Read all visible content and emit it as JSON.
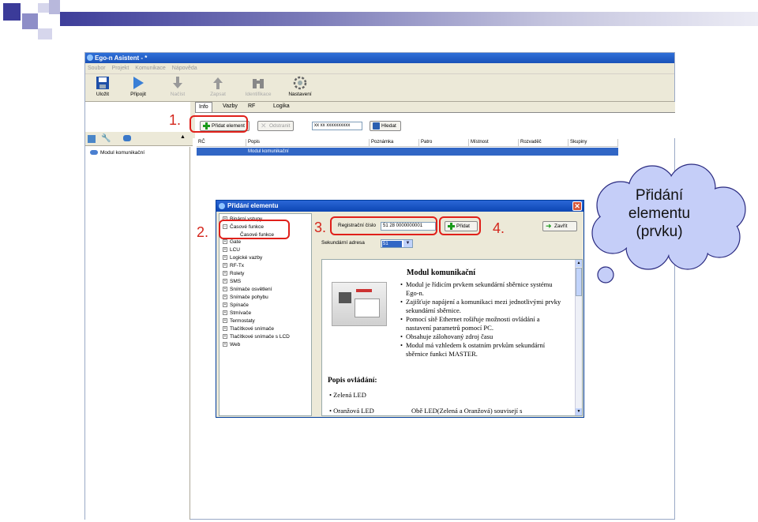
{
  "app": {
    "title": "Ego-n Asistent - *",
    "menu": [
      "Soubor",
      "Projekt",
      "Komunikace",
      "Nápověda"
    ],
    "toolbar": [
      {
        "label": "Uložit",
        "icon": "save-icon"
      },
      {
        "label": "Připojit",
        "icon": "connect-icon"
      },
      {
        "label": "Načíst",
        "icon": "download-icon"
      },
      {
        "label": "Zapsat",
        "icon": "upload-icon"
      },
      {
        "label": "Identifikace",
        "icon": "binoculars-icon"
      },
      {
        "label": "Nastavení",
        "icon": "gear-icon"
      }
    ],
    "tabs": [
      "Info",
      "Vazby",
      "RF",
      "Logika"
    ],
    "add_button": "Přidat element",
    "remove_button": "Odstranit",
    "search_value": "xx xx xxxxxxxxxx",
    "search_button": "Hledat",
    "tree_root": "Modul komunikační",
    "columns": [
      "RČ",
      "Popis",
      "Poznámka",
      "Patro",
      "Místnost",
      "Rozvaděč",
      "Skupiny"
    ],
    "selected_row": {
      "rc": "",
      "popis": "Modul komunikační"
    }
  },
  "dialog": {
    "title": "Přidání elementu",
    "tree": [
      {
        "label": "Binární vstupy",
        "pm": "+"
      },
      {
        "label": "Časové funkce",
        "pm": "−"
      },
      {
        "label": "Časové funkce",
        "child": true
      },
      {
        "label": "Gate",
        "pm": "+"
      },
      {
        "label": "LCU",
        "pm": "+"
      },
      {
        "label": "Logické vazby",
        "pm": "+"
      },
      {
        "label": "RF-Tx",
        "pm": "+"
      },
      {
        "label": "Rolety",
        "pm": "+"
      },
      {
        "label": "SMS",
        "pm": "+"
      },
      {
        "label": "Snímače osvětlení",
        "pm": "+"
      },
      {
        "label": "Snímače pohybu",
        "pm": "+"
      },
      {
        "label": "Spínače",
        "pm": "+"
      },
      {
        "label": "Stmívače",
        "pm": "+"
      },
      {
        "label": "Termostaty",
        "pm": "+"
      },
      {
        "label": "Tlačítkové snímače",
        "pm": "+"
      },
      {
        "label": "Tlačítkové snímače s LCD",
        "pm": "+"
      },
      {
        "label": "Web",
        "pm": "+"
      }
    ],
    "reg_label": "Registrační číslo",
    "reg_value": "51 28 0000000001",
    "add_button": "Přidat",
    "close_button": "Zavřít",
    "sec_label": "Sekundární adresa",
    "sec_value": "51",
    "content": {
      "heading": "Modul komunikační",
      "bullets": [
        "Modul je řídicím prvkem sekundární sběrnice systému Ego-n.",
        "Zajišťuje napájení a komunikaci mezi jednotlivými prvky sekundární sběrnice.",
        "Pomocí sítě Ethernet rošiřuje možnosti ovládání a nastavení parametrů pomocí PC.",
        "Obsahuje zálohovaný zdroj času",
        "Modul má vzhledem k ostatním prvkům sekundární sběrnice funkci MASTER."
      ],
      "controls_heading": "Popis ovládání:",
      "controls": [
        "Zelená LED",
        "Oranžová LED"
      ],
      "controls_desc": "Obě LED(Zelená a Oranžová) souvisejí s"
    }
  },
  "annotations": {
    "n1": "1.",
    "n2": "2.",
    "n3": "3.",
    "n4": "4."
  },
  "cloud": {
    "line1": "Přidání",
    "line2": "elementu",
    "line3": "(prvku)"
  },
  "colors": {
    "accent_red": "#e0201a",
    "title_blue": "#1a52b8",
    "selection": "#3166c5"
  }
}
